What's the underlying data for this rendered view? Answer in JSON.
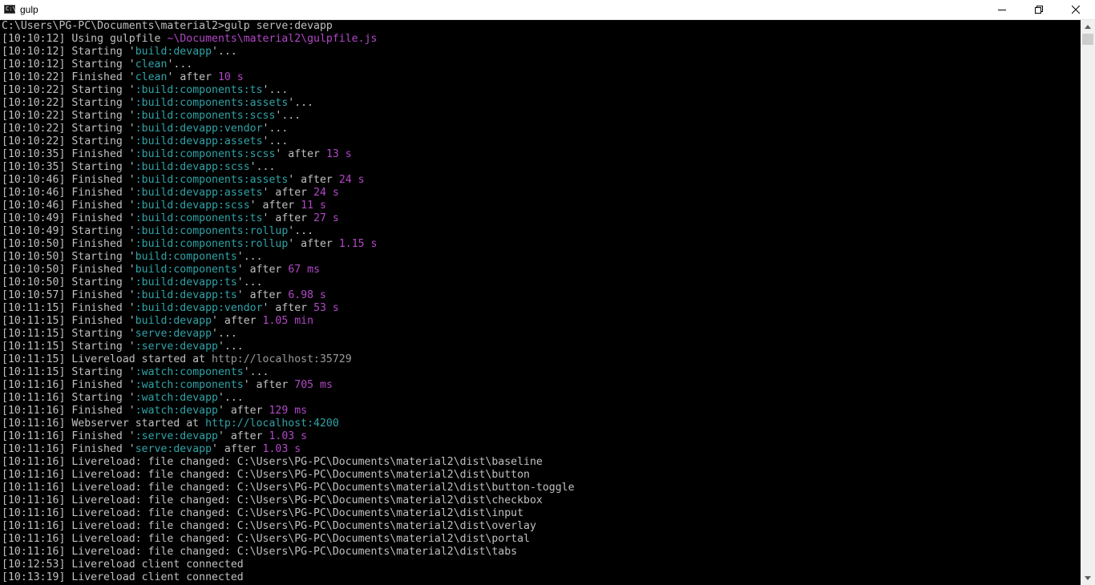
{
  "window": {
    "title": "gulp",
    "icon": "console-icon",
    "icon_text": "C:\\"
  },
  "colors": {
    "background": "#000000",
    "text": "#c0c0c0",
    "task": "#2fa3a8",
    "duration": "#b148c6",
    "path": "#9a9a9a"
  },
  "terminal": {
    "lines": [
      [
        {
          "t": "C:\\Users\\PG-PC\\Documents\\material2>gulp serve:devapp"
        }
      ],
      [
        {
          "t": "[10:10:12] Using gulpfile "
        },
        {
          "t": "~\\Documents\\material2\\gulpfile.js",
          "c": "mag"
        }
      ],
      [
        {
          "t": "[10:10:12] Starting '"
        },
        {
          "t": "build:devapp",
          "c": "cyan"
        },
        {
          "t": "'..."
        }
      ],
      [
        {
          "t": "[10:10:12] Starting '"
        },
        {
          "t": "clean",
          "c": "cyan"
        },
        {
          "t": "'..."
        }
      ],
      [
        {
          "t": "[10:10:22] Finished '"
        },
        {
          "t": "clean",
          "c": "cyan"
        },
        {
          "t": "' after "
        },
        {
          "t": "10 s",
          "c": "mag"
        }
      ],
      [
        {
          "t": "[10:10:22] Starting '"
        },
        {
          "t": ":build:components:ts",
          "c": "cyan"
        },
        {
          "t": "'..."
        }
      ],
      [
        {
          "t": "[10:10:22] Starting '"
        },
        {
          "t": ":build:components:assets",
          "c": "cyan"
        },
        {
          "t": "'..."
        }
      ],
      [
        {
          "t": "[10:10:22] Starting '"
        },
        {
          "t": ":build:components:scss",
          "c": "cyan"
        },
        {
          "t": "'..."
        }
      ],
      [
        {
          "t": "[10:10:22] Starting '"
        },
        {
          "t": ":build:devapp:vendor",
          "c": "cyan"
        },
        {
          "t": "'..."
        }
      ],
      [
        {
          "t": "[10:10:22] Starting '"
        },
        {
          "t": ":build:devapp:assets",
          "c": "cyan"
        },
        {
          "t": "'..."
        }
      ],
      [
        {
          "t": "[10:10:35] Finished '"
        },
        {
          "t": ":build:components:scss",
          "c": "cyan"
        },
        {
          "t": "' after "
        },
        {
          "t": "13 s",
          "c": "mag"
        }
      ],
      [
        {
          "t": "[10:10:35] Starting '"
        },
        {
          "t": ":build:devapp:scss",
          "c": "cyan"
        },
        {
          "t": "'..."
        }
      ],
      [
        {
          "t": "[10:10:46] Finished '"
        },
        {
          "t": ":build:components:assets",
          "c": "cyan"
        },
        {
          "t": "' after "
        },
        {
          "t": "24 s",
          "c": "mag"
        }
      ],
      [
        {
          "t": "[10:10:46] Finished '"
        },
        {
          "t": ":build:devapp:assets",
          "c": "cyan"
        },
        {
          "t": "' after "
        },
        {
          "t": "24 s",
          "c": "mag"
        }
      ],
      [
        {
          "t": "[10:10:46] Finished '"
        },
        {
          "t": ":build:devapp:scss",
          "c": "cyan"
        },
        {
          "t": "' after "
        },
        {
          "t": "11 s",
          "c": "mag"
        }
      ],
      [
        {
          "t": "[10:10:49] Finished '"
        },
        {
          "t": ":build:components:ts",
          "c": "cyan"
        },
        {
          "t": "' after "
        },
        {
          "t": "27 s",
          "c": "mag"
        }
      ],
      [
        {
          "t": "[10:10:49] Starting '"
        },
        {
          "t": ":build:components:rollup",
          "c": "cyan"
        },
        {
          "t": "'..."
        }
      ],
      [
        {
          "t": "[10:10:50] Finished '"
        },
        {
          "t": ":build:components:rollup",
          "c": "cyan"
        },
        {
          "t": "' after "
        },
        {
          "t": "1.15 s",
          "c": "mag"
        }
      ],
      [
        {
          "t": "[10:10:50] Starting '"
        },
        {
          "t": "build:components",
          "c": "cyan"
        },
        {
          "t": "'..."
        }
      ],
      [
        {
          "t": "[10:10:50] Finished '"
        },
        {
          "t": "build:components",
          "c": "cyan"
        },
        {
          "t": "' after "
        },
        {
          "t": "67 ms",
          "c": "mag"
        }
      ],
      [
        {
          "t": "[10:10:50] Starting '"
        },
        {
          "t": ":build:devapp:ts",
          "c": "cyan"
        },
        {
          "t": "'..."
        }
      ],
      [
        {
          "t": "[10:10:57] Finished '"
        },
        {
          "t": ":build:devapp:ts",
          "c": "cyan"
        },
        {
          "t": "' after "
        },
        {
          "t": "6.98 s",
          "c": "mag"
        }
      ],
      [
        {
          "t": "[10:11:15] Finished '"
        },
        {
          "t": ":build:devapp:vendor",
          "c": "cyan"
        },
        {
          "t": "' after "
        },
        {
          "t": "53 s",
          "c": "mag"
        }
      ],
      [
        {
          "t": "[10:11:15] Finished '"
        },
        {
          "t": "build:devapp",
          "c": "cyan"
        },
        {
          "t": "' after "
        },
        {
          "t": "1.05 min",
          "c": "mag"
        }
      ],
      [
        {
          "t": "[10:11:15] Starting '"
        },
        {
          "t": "serve:devapp",
          "c": "cyan"
        },
        {
          "t": "'..."
        }
      ],
      [
        {
          "t": "[10:11:15] Starting '"
        },
        {
          "t": ":serve:devapp",
          "c": "cyan"
        },
        {
          "t": "'..."
        }
      ],
      [
        {
          "t": "[10:11:15] Livereload started at "
        },
        {
          "t": "http://localhost:35729",
          "c": "grey"
        }
      ],
      [
        {
          "t": "[10:11:15] Starting '"
        },
        {
          "t": ":watch:components",
          "c": "cyan"
        },
        {
          "t": "'..."
        }
      ],
      [
        {
          "t": "[10:11:16] Finished '"
        },
        {
          "t": ":watch:components",
          "c": "cyan"
        },
        {
          "t": "' after "
        },
        {
          "t": "705 ms",
          "c": "mag"
        }
      ],
      [
        {
          "t": "[10:11:16] Starting '"
        },
        {
          "t": ":watch:devapp",
          "c": "cyan"
        },
        {
          "t": "'..."
        }
      ],
      [
        {
          "t": "[10:11:16] Finished '"
        },
        {
          "t": ":watch:devapp",
          "c": "cyan"
        },
        {
          "t": "' after "
        },
        {
          "t": "129 ms",
          "c": "mag"
        }
      ],
      [
        {
          "t": "[10:11:16] Webserver started at "
        },
        {
          "t": "http://localhost:4200",
          "c": "cyan"
        }
      ],
      [
        {
          "t": "[10:11:16] Finished '"
        },
        {
          "t": ":serve:devapp",
          "c": "cyan"
        },
        {
          "t": "' after "
        },
        {
          "t": "1.03 s",
          "c": "mag"
        }
      ],
      [
        {
          "t": "[10:11:16] Finished '"
        },
        {
          "t": "serve:devapp",
          "c": "cyan"
        },
        {
          "t": "' after "
        },
        {
          "t": "1.03 s",
          "c": "mag"
        }
      ],
      [
        {
          "t": "[10:11:16] Livereload: file changed: C:\\Users\\PG-PC\\Documents\\material2\\dist\\baseline"
        }
      ],
      [
        {
          "t": "[10:11:16] Livereload: file changed: C:\\Users\\PG-PC\\Documents\\material2\\dist\\button"
        }
      ],
      [
        {
          "t": "[10:11:16] Livereload: file changed: C:\\Users\\PG-PC\\Documents\\material2\\dist\\button-toggle"
        }
      ],
      [
        {
          "t": "[10:11:16] Livereload: file changed: C:\\Users\\PG-PC\\Documents\\material2\\dist\\checkbox"
        }
      ],
      [
        {
          "t": "[10:11:16] Livereload: file changed: C:\\Users\\PG-PC\\Documents\\material2\\dist\\input"
        }
      ],
      [
        {
          "t": "[10:11:16] Livereload: file changed: C:\\Users\\PG-PC\\Documents\\material2\\dist\\overlay"
        }
      ],
      [
        {
          "t": "[10:11:16] Livereload: file changed: C:\\Users\\PG-PC\\Documents\\material2\\dist\\portal"
        }
      ],
      [
        {
          "t": "[10:11:16] Livereload: file changed: C:\\Users\\PG-PC\\Documents\\material2\\dist\\tabs"
        }
      ],
      [
        {
          "t": "[10:12:53] Livereload client connected"
        }
      ],
      [
        {
          "t": "[10:13:19] Livereload client connected"
        }
      ]
    ]
  }
}
